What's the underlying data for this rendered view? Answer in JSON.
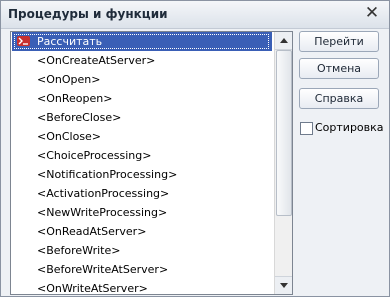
{
  "window": {
    "title": "Процедуры и функции"
  },
  "list": {
    "items": [
      {
        "label": "Рассчитать",
        "selected": true,
        "icon": "method-icon"
      },
      {
        "label": "<OnCreateAtServer>"
      },
      {
        "label": "<OnOpen>"
      },
      {
        "label": "<OnReopen>"
      },
      {
        "label": "<BeforeClose>"
      },
      {
        "label": "<OnClose>"
      },
      {
        "label": "<ChoiceProcessing>"
      },
      {
        "label": "<NotificationProcessing>"
      },
      {
        "label": "<ActivationProcessing>"
      },
      {
        "label": "<NewWriteProcessing>"
      },
      {
        "label": "<OnReadAtServer>"
      },
      {
        "label": "<BeforeWrite>"
      },
      {
        "label": "<BeforeWriteAtServer>"
      },
      {
        "label": "<OnWriteAtServer>"
      }
    ]
  },
  "buttons": {
    "go": "Перейти",
    "cancel": "Отмена",
    "help": "Справка"
  },
  "sort": {
    "label": "Сортировка",
    "checked": false
  }
}
